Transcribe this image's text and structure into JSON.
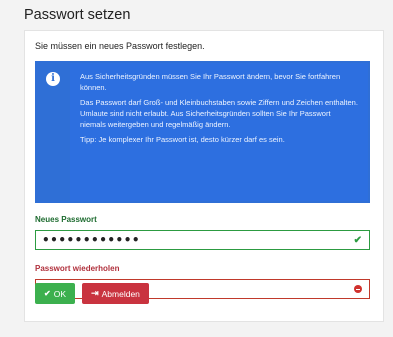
{
  "page": {
    "title": "Passwort setzen",
    "lead": "Sie müssen ein neues Passwort festlegen."
  },
  "info": {
    "icon": "info-icon",
    "paragraphs": [
      "Aus Sicherheitsgründen müssen Sie Ihr Passwort ändern, bevor Sie fortfahren können.",
      "Das Passwort darf Groß- und Kleinbuchstaben sowie Ziffern und Zeichen enthalten. Umlaute sind nicht erlaubt. Aus Sicherheitsgründen sollten Sie Ihr Passwort niemals weitergeben und regelmäßig ändern.",
      "Tipp: Je komplexer Ihr Passwort ist, desto kürzer darf es sein."
    ]
  },
  "form": {
    "new_password": {
      "label": "Neues Passwort",
      "value": "••••••••••••",
      "state": "valid",
      "state_icon": "check-icon"
    },
    "repeat_password": {
      "label": "Passwort wiederholen",
      "value": "••",
      "state": "invalid",
      "state_icon": "minus-circle-icon"
    }
  },
  "buttons": {
    "ok": {
      "label": "OK",
      "icon": "check-icon"
    },
    "logout": {
      "label": "Abmelden",
      "icon": "sign-out-icon"
    }
  },
  "colors": {
    "info_blue": "#2d6fe0",
    "valid_green": "#2c9b41",
    "invalid_red": "#c0392b"
  }
}
